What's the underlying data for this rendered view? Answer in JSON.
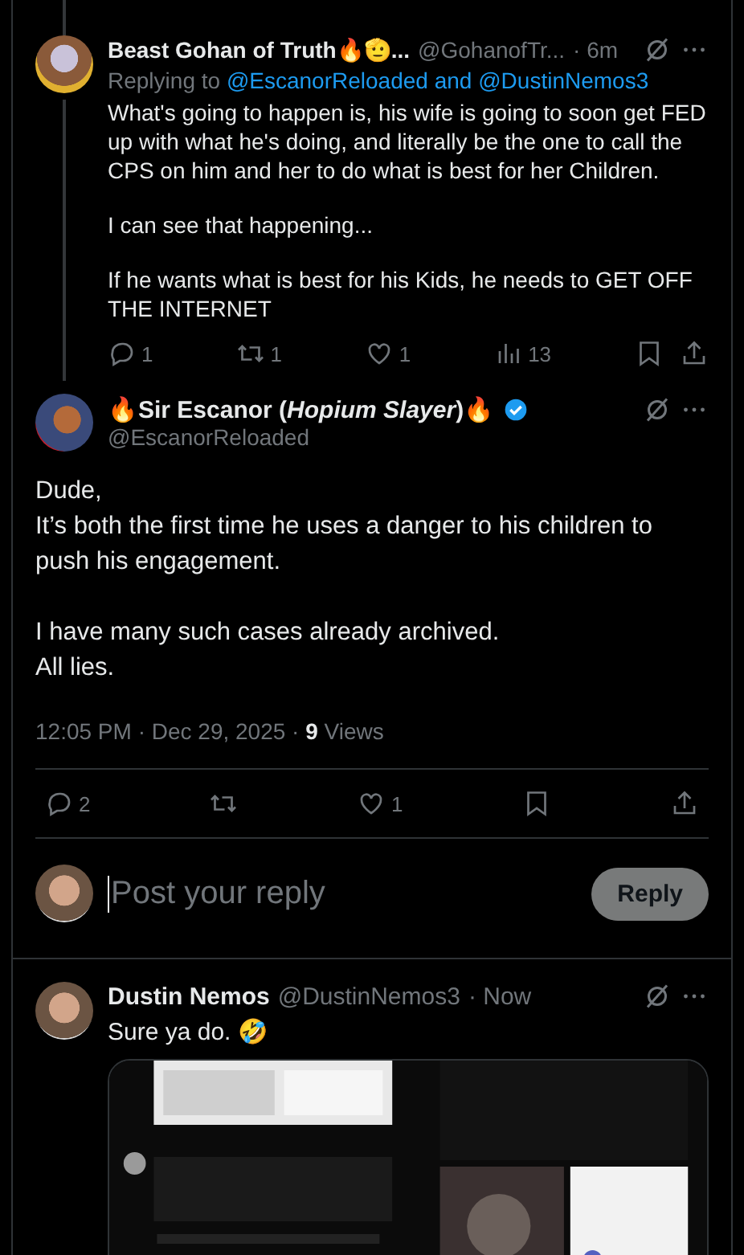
{
  "parent_post": {
    "author_name": "Beast Gohan of Truth🔥🫡...",
    "handle": "@GohanofTr...",
    "time": "· 6m",
    "replying_prefix": "Replying to",
    "replying_mentions": "@EscanorReloaded and @DustinNemos3",
    "paragraphs": [
      "What's going to happen is, his wife is going to soon get FED up with what he's doing, and literally be the one to call the CPS on him and her to do what is best for her Children.",
      "I can see that happening...",
      "If he wants what is best for his Kids, he needs to GET OFF THE INTERNET"
    ],
    "actions": [
      {
        "kind": "reply",
        "count": "1"
      },
      {
        "kind": "repost",
        "count": "1"
      },
      {
        "kind": "like",
        "count": "1"
      },
      {
        "kind": "views",
        "count": "13"
      },
      {
        "kind": "bookmark"
      },
      {
        "kind": "share"
      }
    ]
  },
  "main_post": {
    "author_name": "🔥Sir Escanor (*Hopium Slayer*)🔥",
    "verified": true,
    "handle": "@EscanorReloaded",
    "paragraphs": [
      "Dude,\nIt’s both the first time he uses a danger to his children to push his engagement.",
      "I have many such cases already archived.\nAll lies."
    ],
    "meta": "12:05 PM · Dec 29, 2025 · **9** Views",
    "actions": [
      {
        "kind": "reply",
        "count": "2"
      },
      {
        "kind": "repost"
      },
      {
        "kind": "like",
        "count": "1"
      },
      {
        "kind": "bookmark"
      },
      {
        "kind": "share"
      }
    ]
  },
  "composer": {
    "placeholder": "Post your reply",
    "button": "Reply",
    "disabled": true
  },
  "reply": {
    "author_name": "Dustin Nemos",
    "handle": "@DustinNemos3",
    "time": "· Now",
    "text": "Sure ya do. 🤣"
  }
}
